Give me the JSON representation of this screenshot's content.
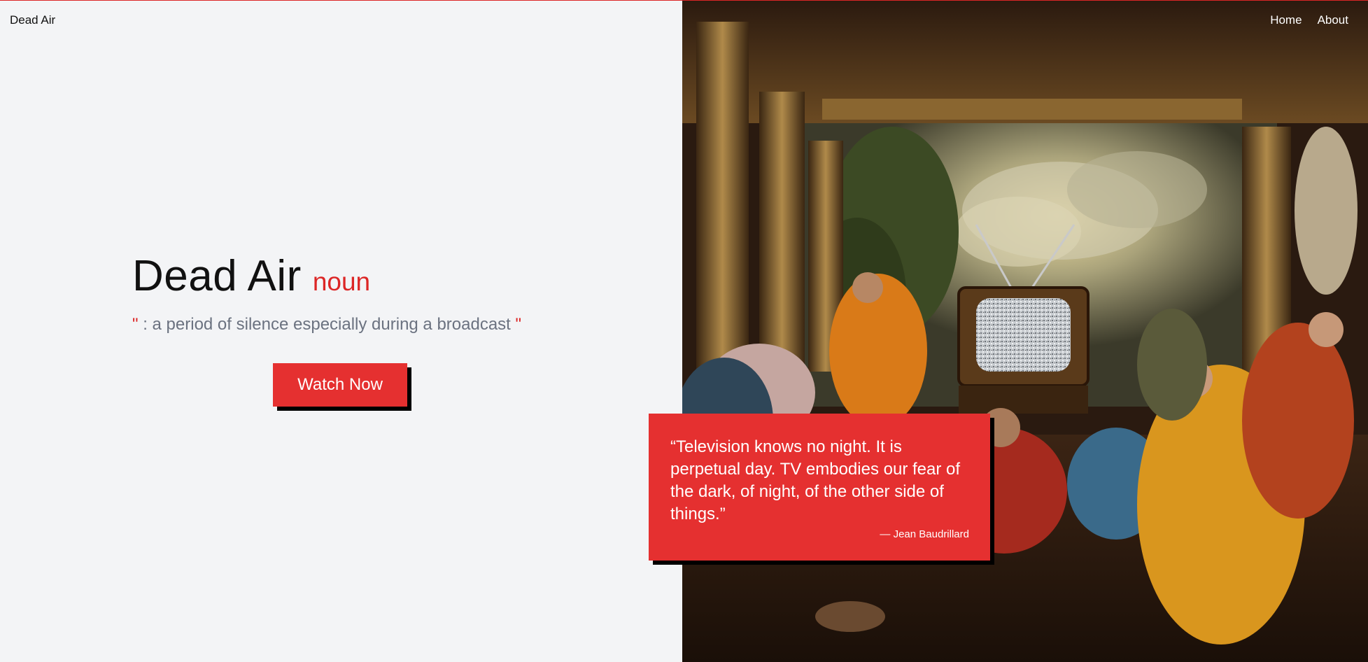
{
  "header": {
    "brand": "Dead Air",
    "nav": [
      {
        "label": "Home"
      },
      {
        "label": "About"
      }
    ]
  },
  "hero": {
    "title": "Dead Air",
    "part_of_speech": "noun",
    "quote_open": "\"",
    "definition": " : a period of silence especially during a broadcast ",
    "quote_close": "\"",
    "cta_label": "Watch Now"
  },
  "quote": {
    "text": "“Television knows no night. It is perpetual day. TV embodies our fear of the dark, of night, of the other side of things.”",
    "author": "— Jean Baudrillard"
  },
  "colors": {
    "accent": "#e53030",
    "background": "#f3f4f6",
    "text": "#111111",
    "muted": "#6b7280"
  },
  "icons": {
    "painting": "baroque-painting-people-watching-tv"
  }
}
